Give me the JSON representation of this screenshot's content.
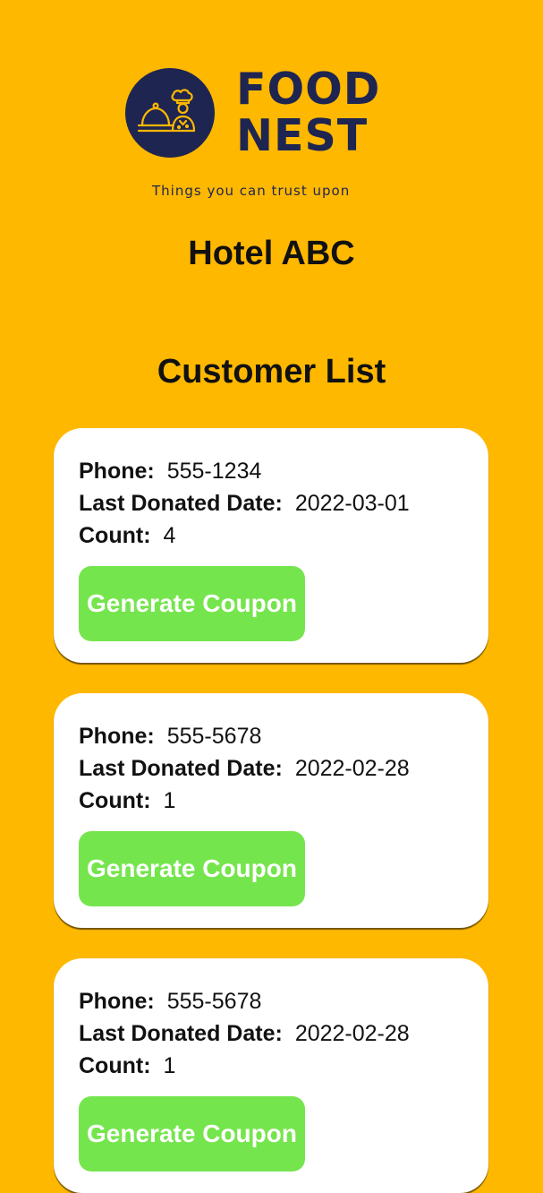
{
  "logo": {
    "brand_line1": "FOOD",
    "brand_line2": "NEST",
    "tagline": "Things you can trust upon",
    "colors": {
      "navy": "#1E2551",
      "accent": "#FFB800"
    }
  },
  "hotel_name": "Hotel ABC",
  "section_title": "Customer List",
  "labels": {
    "phone": "Phone:",
    "last_donated_date": "Last Donated Date:",
    "count": "Count:",
    "coupon_button": "Generate Coupon"
  },
  "customers": [
    {
      "phone": "555-1234",
      "last_donated_date": "2022-03-01",
      "count": "4"
    },
    {
      "phone": "555-5678",
      "last_donated_date": "2022-02-28",
      "count": "1"
    },
    {
      "phone": "555-5678",
      "last_donated_date": "2022-02-28",
      "count": "1"
    }
  ],
  "theme": {
    "background": "#FFB800",
    "card": "#FFFFFF",
    "button": "#75E54D",
    "button_text": "#FFFFFF"
  }
}
